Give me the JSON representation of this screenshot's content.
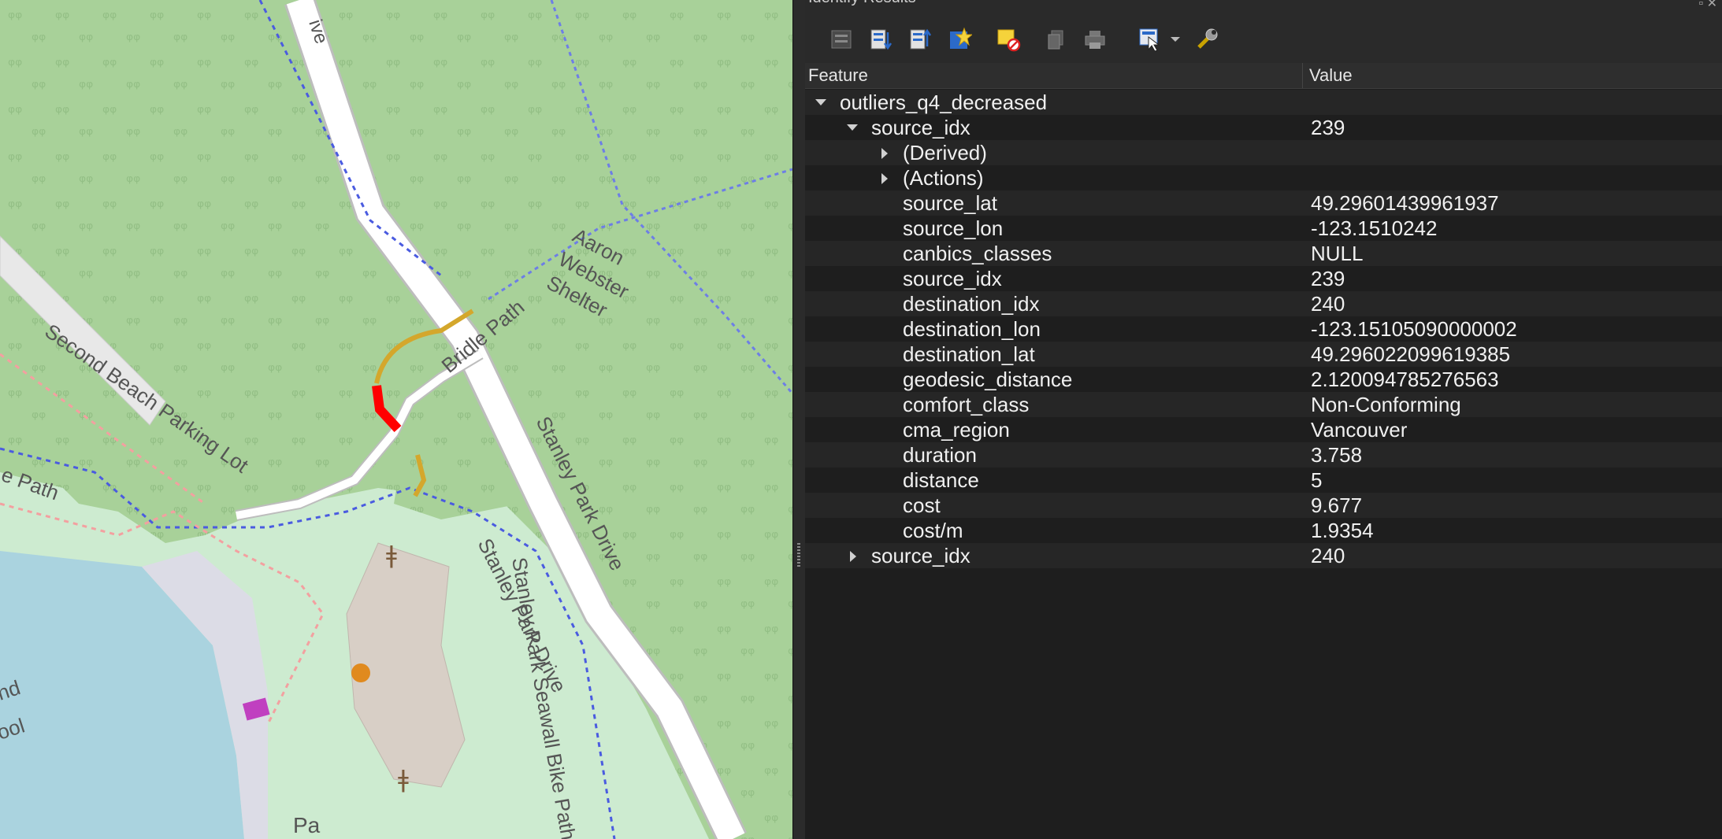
{
  "panel": {
    "title": "Identify Results",
    "toolbar": [
      {
        "name": "expand-tree-icon"
      },
      {
        "name": "expand-all-icon"
      },
      {
        "name": "collapse-all-icon"
      },
      {
        "name": "highlight-features-icon"
      },
      {
        "name": "clear-selection-icon"
      },
      {
        "name": "copy-icon"
      },
      {
        "name": "print-icon"
      },
      {
        "name": "identify-mode-icon"
      },
      {
        "name": "settings-wrench-icon"
      }
    ],
    "headers": {
      "feature": "Feature",
      "value": "Value"
    },
    "layer": "outliers_q4_decreased",
    "feature_1": {
      "key": "source_idx",
      "value": "239"
    },
    "derived": "(Derived)",
    "actions": "(Actions)",
    "attributes": [
      {
        "key": "source_lat",
        "value": "49.29601439961937"
      },
      {
        "key": "source_lon",
        "value": "-123.1510242"
      },
      {
        "key": "canbics_classes",
        "value": "NULL"
      },
      {
        "key": "source_idx",
        "value": "239"
      },
      {
        "key": "destination_idx",
        "value": "240"
      },
      {
        "key": "destination_lon",
        "value": "-123.15105090000002"
      },
      {
        "key": "destination_lat",
        "value": "49.296022099619385"
      },
      {
        "key": "geodesic_distance",
        "value": "2.120094785276563"
      },
      {
        "key": "comfort_class",
        "value": "Non-Conforming"
      },
      {
        "key": "cma_region",
        "value": "Vancouver"
      },
      {
        "key": "duration",
        "value": "3.758"
      },
      {
        "key": "distance",
        "value": "5"
      },
      {
        "key": "cost",
        "value": "9.677"
      },
      {
        "key": "cost/m",
        "value": "1.9354"
      }
    ],
    "feature_2": {
      "key": "source_idx",
      "value": "240"
    }
  },
  "map": {
    "labels": {
      "ive": "ive",
      "aaron": "Aaron",
      "webster": "Webster",
      "shelter": "Shelter",
      "bridle": "Bridle Path",
      "second_beach": "Second Beach Parking Lot",
      "e_path": "e Path",
      "stanley_drive_1": "Stanley Park Drive",
      "stanley_drive_2": "Stanley Park Drive",
      "seawall": "Stanley Park Seawall Bike Path",
      "nd": "nd",
      "ool": "ool",
      "pa": "Pa"
    },
    "colors": {
      "forest": "#add19e",
      "grass": "#cdebd0",
      "water": "#aad3df",
      "route_red": "#ff0000",
      "route_gold": "#d4a72c"
    }
  }
}
